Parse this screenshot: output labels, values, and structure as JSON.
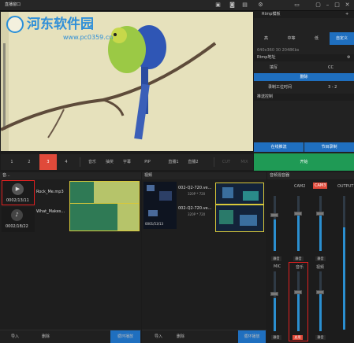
{
  "window": {
    "title": "直播窗口"
  },
  "watermark": {
    "line1": "河东软件园",
    "line2": "www.pc0359.cn"
  },
  "scene_bar": {
    "scenes": [
      "1",
      "2",
      "3",
      "4"
    ],
    "active_scene": "3",
    "modes": [
      "音乐",
      "抽奖",
      "字幕",
      "PIP",
      "直播1",
      "直播2",
      "CUT",
      "MIX"
    ]
  },
  "rtmp": {
    "header": "Rtmp模板",
    "quality_tabs": [
      "高",
      "中等",
      "低",
      "自定义"
    ],
    "active_tab": "自定义",
    "resolution_info": "640x360  30  2048Kbs",
    "address_label": "Rtmp地址",
    "name_label": "填写",
    "cc_label": "CC",
    "delete_label": "删除",
    "record_label": "录制工位时间",
    "record_value": "3 - 2",
    "push_header": "推送控制",
    "live_push_label": "在线推流",
    "program_record_label": "节目录制",
    "start_label": "开始"
  },
  "music": {
    "header": "音...",
    "clips": [
      {
        "time": "0002/13/11",
        "name": "Rock_Me.mp3"
      },
      {
        "time": "0002/18/22",
        "name": "What_Makes..."
      }
    ],
    "import_label": "导入",
    "delete_label": "删除",
    "loop_label": "循环播放"
  },
  "video": {
    "header": "视频",
    "clips": [
      {
        "name": "002-Q2-720.ve...",
        "meta": "320P * 720",
        "time": "0001/53/13"
      },
      {
        "name": "002-Q2-720.ve...",
        "meta": "320P * 720",
        "time": "0001/53/13"
      }
    ],
    "import_label": "导入",
    "delete_label": "删除",
    "loop_label": "循环播放"
  },
  "mixer": {
    "header": "音频混音器",
    "top_channels": [
      "CAM2",
      "CAM3",
      "OUTPUT"
    ],
    "bottom_channels": [
      "MIC",
      "音乐",
      "视频"
    ],
    "mute_label": "静音",
    "active_label": "启用"
  },
  "colors": {
    "accent_blue": "#1f6fbf",
    "active_red": "#e04a3a",
    "start_green": "#1f9a55",
    "highlight_red": "#e02020"
  }
}
